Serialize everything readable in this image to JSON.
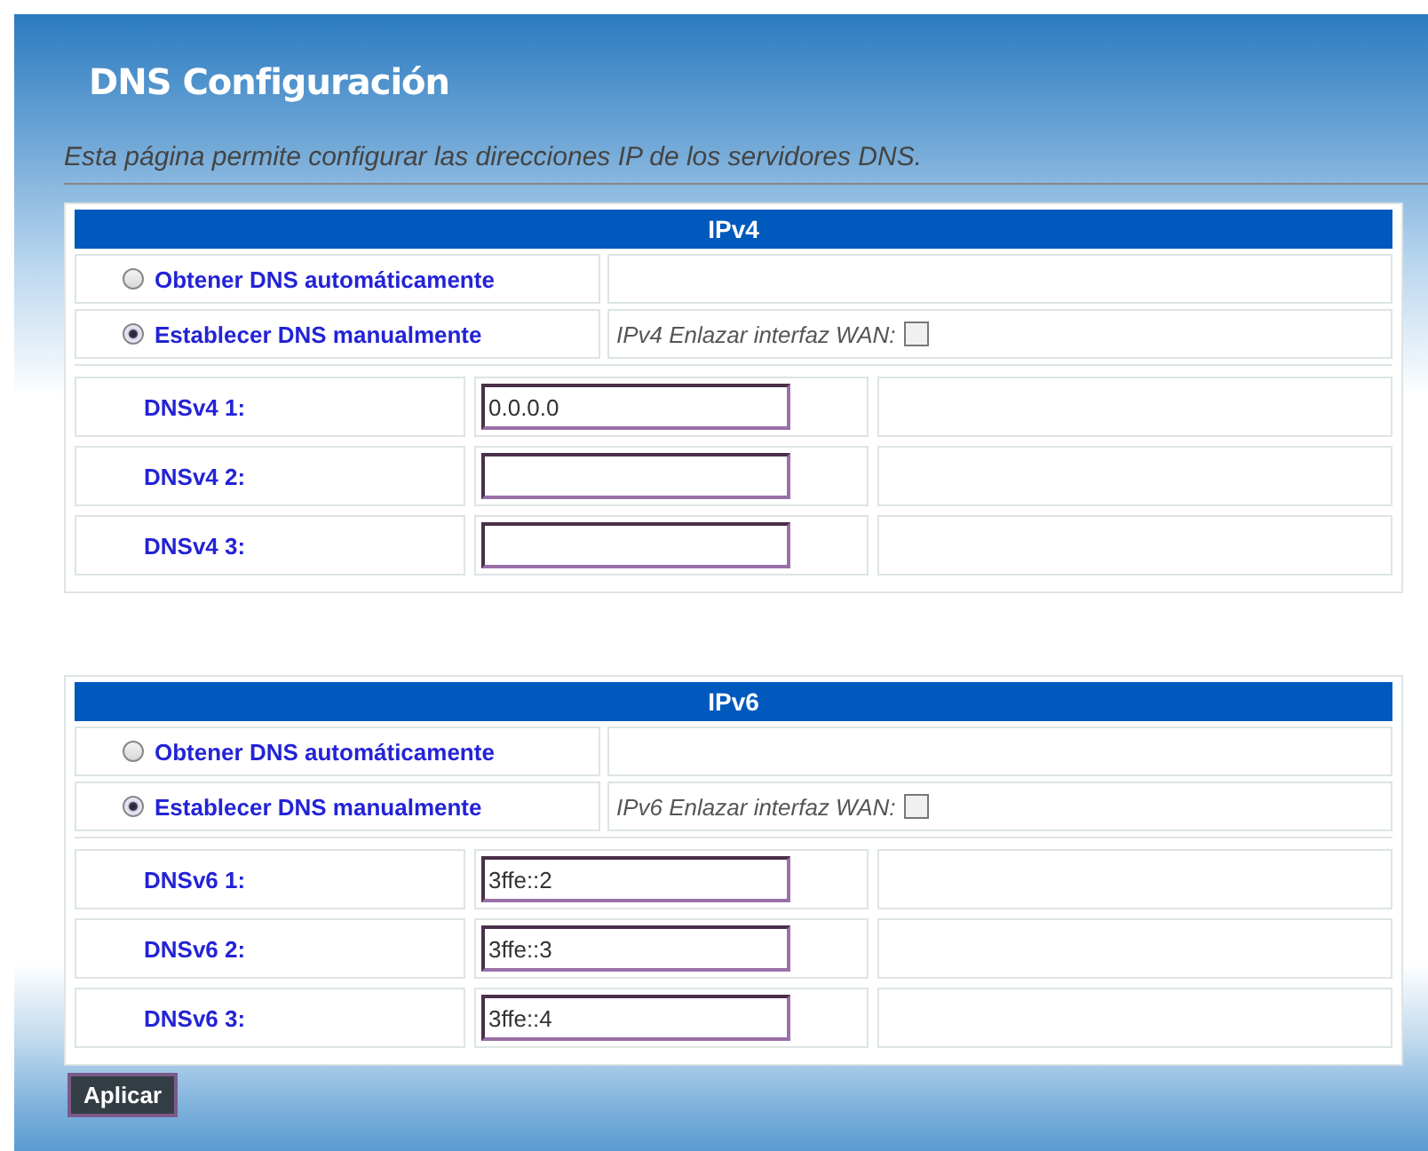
{
  "title": "DNS Configuración",
  "description": "Esta página permite configurar las direcciones IP de los servidores DNS.",
  "sections": [
    {
      "header": "IPv4",
      "options": [
        {
          "label": "Obtener DNS automáticamente",
          "selected": false
        },
        {
          "label": "Establecer DNS manualmente",
          "selected": true
        }
      ],
      "wan_bind": {
        "label": "IPv4 Enlazar interfaz WAN:",
        "checked": false
      },
      "fields": [
        {
          "label": "DNSv4 1:",
          "value": "0.0.0.0"
        },
        {
          "label": "DNSv4 2:"
        },
        {
          "label": "DNSv4 3:"
        }
      ]
    },
    {
      "header": "IPv6",
      "options": [
        {
          "label": "Obtener DNS automáticamente",
          "selected": false
        },
        {
          "label": "Establecer DNS manualmente",
          "selected": true
        }
      ],
      "wan_bind": {
        "label": "IPv6 Enlazar interfaz WAN:",
        "checked": false
      },
      "fields": [
        {
          "label": "DNSv6 1:",
          "value": "3ffe::2"
        },
        {
          "label": "DNSv6 2:",
          "value": "3ffe::3"
        },
        {
          "label": "DNSv6 3:",
          "value": "3ffe::4"
        }
      ]
    }
  ],
  "button": "Aplicar"
}
